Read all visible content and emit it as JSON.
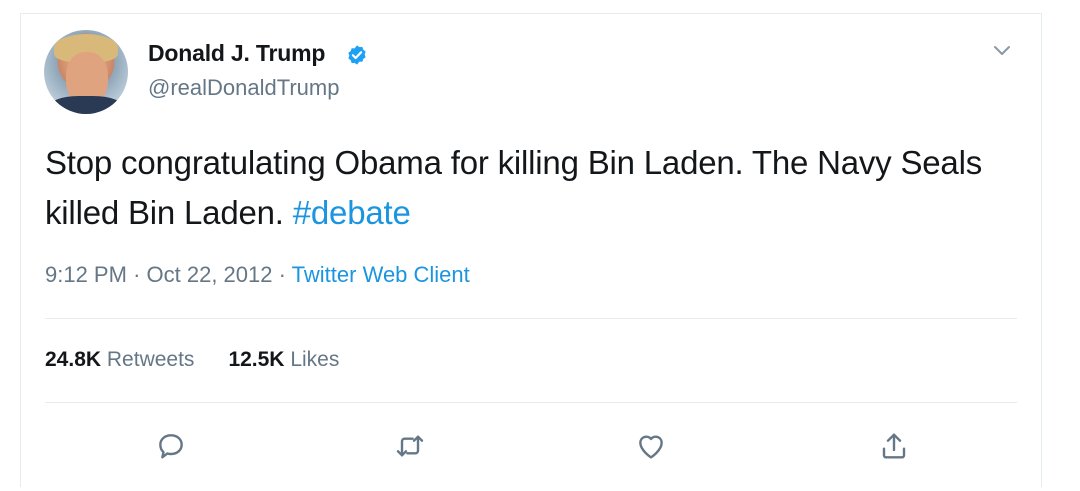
{
  "tweet": {
    "display_name": "Donald J. Trump",
    "handle": "@realDonaldTrump",
    "text": "Stop congratulating Obama for killing Bin Laden. The Navy Seals killed Bin Laden. ",
    "hashtag": "#debate",
    "time": "9:12 PM",
    "date": "Oct 22, 2012",
    "separator": "·",
    "source": "Twitter Web Client"
  },
  "stats": {
    "retweets_count": "24.8K",
    "retweets_label": "Retweets",
    "likes_count": "12.5K",
    "likes_label": "Likes"
  },
  "icons": {
    "verified": "verified-badge-icon",
    "caret": "chevron-down-icon",
    "reply": "reply-icon",
    "retweet": "retweet-icon",
    "like": "heart-icon",
    "share": "share-icon"
  },
  "colors": {
    "text": "#14171a",
    "secondary": "#657786",
    "accent": "#1b95e0",
    "verified": "#1da1f2",
    "divider": "#e6ecf0"
  }
}
